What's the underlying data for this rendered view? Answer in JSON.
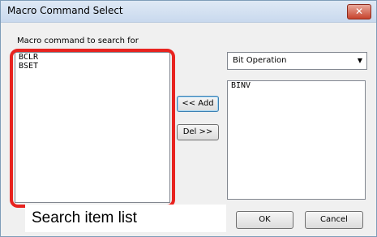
{
  "window": {
    "title": "Macro Command Select",
    "close_symbol": "✕"
  },
  "search": {
    "label": "Macro command to search for",
    "items": [
      "BCLR",
      "BSET"
    ]
  },
  "category": {
    "selected": "Bit Operation",
    "arrow": "▼"
  },
  "macros": {
    "items": [
      "BINV"
    ]
  },
  "buttons": {
    "add": "<< Add",
    "del": "Del >>",
    "ok": "OK",
    "cancel": "Cancel"
  },
  "annotation": {
    "caption": "Search item list",
    "highlight_color": "#e8231f"
  }
}
